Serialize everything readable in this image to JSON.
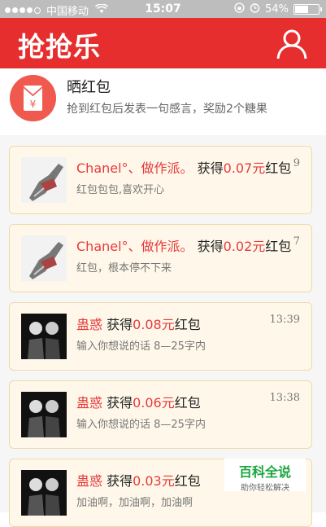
{
  "status_bar": {
    "carrier": "中国移动",
    "time": "15:07",
    "battery_percent": "54%",
    "battery_level": 0.54
  },
  "header": {
    "title": "抢抢乐"
  },
  "share": {
    "title": "晒红包",
    "subtitle": "抢到红包后发表一句感言，奖励2个糖果"
  },
  "feed": [
    {
      "nickname": "Chanel°、做作派。",
      "prefix": " 获得",
      "amount": "0.07元",
      "suffix": "红包",
      "time": "9",
      "message": "红包包包,喜欢开心",
      "avatar": "shoe"
    },
    {
      "nickname": "Chanel°、做作派。",
      "prefix": " 获得",
      "amount": "0.02元",
      "suffix": "红包",
      "time": "7",
      "message": "红包，根本停不下来",
      "avatar": "shoe"
    },
    {
      "nickname": "蛊惑",
      "prefix": " 获得",
      "amount": "0.08元",
      "suffix": "红包",
      "time": "13:39",
      "message": "输入你想说的话 8—25字内",
      "avatar": "photo"
    },
    {
      "nickname": "蛊惑",
      "prefix": " 获得",
      "amount": "0.06元",
      "suffix": "红包",
      "time": "13:38",
      "message": "输入你想说的话 8—25字内",
      "avatar": "photo"
    },
    {
      "nickname": "蛊惑",
      "prefix": " 获得",
      "amount": "0.03元",
      "suffix": "红包",
      "time": "",
      "message": "加油啊，加油啊，加油啊",
      "avatar": "photo"
    }
  ],
  "watermark": {
    "title": "百科全说",
    "subtitle": "助你轻松解决"
  },
  "colors": {
    "header_bg": "#e62e2e",
    "accent_red": "#e63a3a",
    "card_bg": "#fff8ea"
  }
}
